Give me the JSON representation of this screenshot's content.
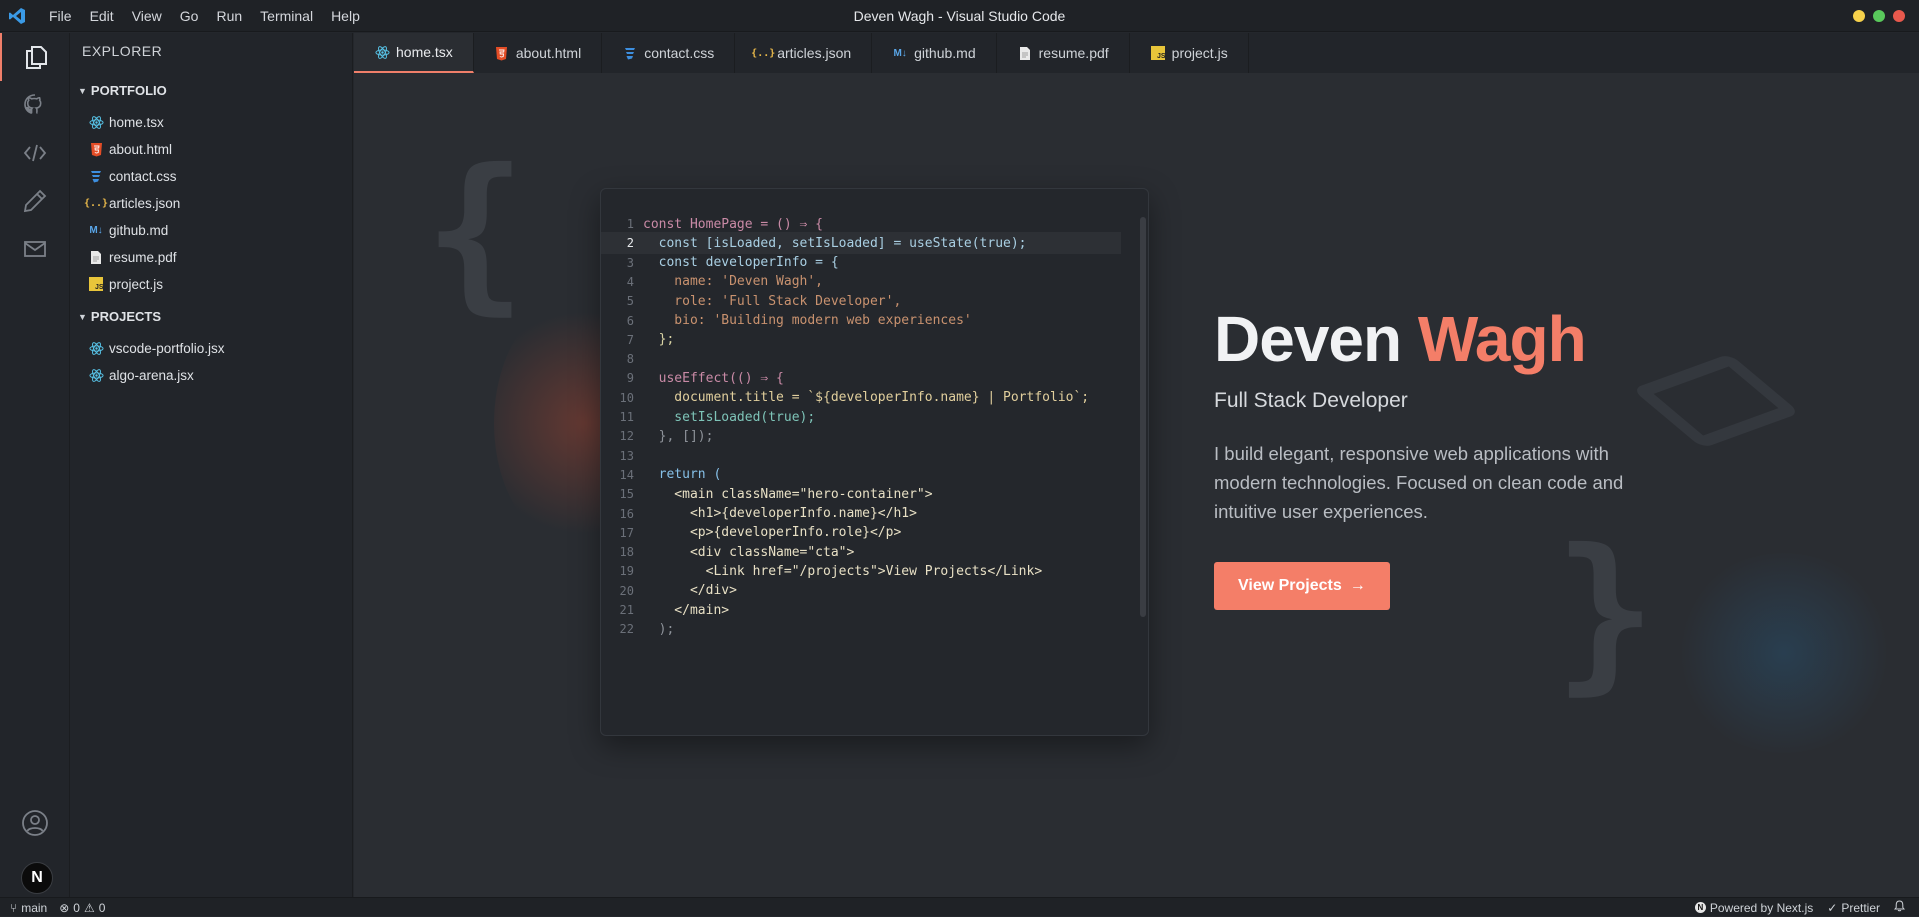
{
  "window": {
    "title": "Deven Wagh - Visual Studio Code"
  },
  "menu": [
    "File",
    "Edit",
    "View",
    "Go",
    "Run",
    "Terminal",
    "Help"
  ],
  "traffic_colors": [
    "#f6d14b",
    "#59c95b",
    "#e8594d"
  ],
  "activity_bar": {
    "items": [
      "files-icon",
      "github-icon",
      "code-icon",
      "pencil-icon",
      "mail-icon"
    ],
    "bottom": [
      "account-icon"
    ],
    "badge": "N"
  },
  "sidebar": {
    "title": "EXPLORER",
    "sections": [
      {
        "label": "PORTFOLIO",
        "files": [
          {
            "name": "home.tsx",
            "icon": "react-icon"
          },
          {
            "name": "about.html",
            "icon": "html-icon"
          },
          {
            "name": "contact.css",
            "icon": "css-icon"
          },
          {
            "name": "articles.json",
            "icon": "json-icon"
          },
          {
            "name": "github.md",
            "icon": "markdown-icon"
          },
          {
            "name": "resume.pdf",
            "icon": "pdf-icon"
          },
          {
            "name": "project.js",
            "icon": "js-icon"
          }
        ]
      },
      {
        "label": "PROJECTS",
        "files": [
          {
            "name": "vscode-portfolio.jsx",
            "icon": "react-icon"
          },
          {
            "name": "algo-arena.jsx",
            "icon": "react-icon"
          }
        ]
      }
    ]
  },
  "tabs": [
    {
      "label": "home.tsx",
      "icon": "react-icon",
      "active": true
    },
    {
      "label": "about.html",
      "icon": "html-icon"
    },
    {
      "label": "contact.css",
      "icon": "css-icon"
    },
    {
      "label": "articles.json",
      "icon": "json-icon"
    },
    {
      "label": "github.md",
      "icon": "markdown-icon"
    },
    {
      "label": "resume.pdf",
      "icon": "pdf-icon"
    },
    {
      "label": "project.js",
      "icon": "js-icon"
    }
  ],
  "code": {
    "current_line": 2,
    "lines": [
      "const HomePage = () ⇒ {",
      "  const [isLoaded, setIsLoaded] = useState(true);",
      "  const developerInfo = {",
      "    name: 'Deven Wagh',",
      "    role: 'Full Stack Developer',",
      "    bio: 'Building modern web experiences'",
      "  };",
      "",
      "  useEffect(() ⇒ {",
      "    document.title = `${developerInfo.name} | Portfolio`;",
      "    setIsLoaded(true);",
      "  }, []);",
      "",
      "  return (",
      "    <main className=\"hero-container\">",
      "      <h1>{developerInfo.name}</h1>",
      "      <p>{developerInfo.role}</p>",
      "      <div className=\"cta\">",
      "        <Link href=\"/projects\">View Projects</Link>",
      "      </div>",
      "    </main>",
      "  );"
    ],
    "line_colors": [
      "#c98aa6",
      "#a9cfe3",
      "#a9cfe3",
      "#c9926f",
      "#c9926f",
      "#c9926f",
      "#d8d2a4",
      "#cfd3d8",
      "#c98aa6",
      "#e1cf9d",
      "#7ec4b8",
      "#8e939a",
      "#cfd3d8",
      "#86c0e8",
      "#e8e0c5",
      "#e8e0c5",
      "#e8e0c5",
      "#e8e0c5",
      "#e8e0c5",
      "#e8e0c5",
      "#e8e0c5",
      "#8e939a"
    ]
  },
  "hero": {
    "first_name": "Deven",
    "last_name": "Wagh",
    "role": "Full Stack Developer",
    "bio": "I build elegant, responsive web applications with modern technologies. Focused on clean code and intuitive user experiences.",
    "cta": "View Projects",
    "accent": "#f47e68"
  },
  "status": {
    "branch": "main",
    "errors": "0",
    "warnings": "0",
    "powered": "Powered by Next.js",
    "prettier": "Prettier"
  }
}
